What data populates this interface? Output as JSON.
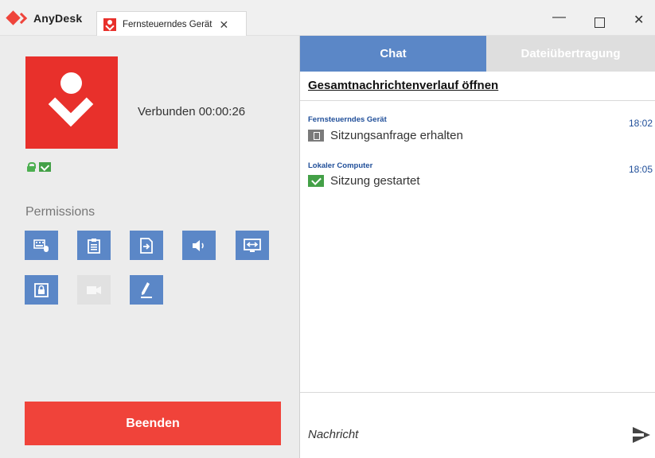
{
  "app": {
    "name": "AnyDesk"
  },
  "tab": {
    "label": "Fernsteuerndes Gerät"
  },
  "status": {
    "text": "Verbunden 00:00:26"
  },
  "permissions": {
    "heading": "Permissions",
    "items": [
      {
        "icon": "keyboard-mouse-icon",
        "enabled": true
      },
      {
        "icon": "clipboard-icon",
        "enabled": true
      },
      {
        "icon": "file-transfer-icon",
        "enabled": true
      },
      {
        "icon": "sound-icon",
        "enabled": true
      },
      {
        "icon": "control-icon",
        "enabled": true
      },
      {
        "icon": "lock-screen-icon",
        "enabled": true
      },
      {
        "icon": "record-session-icon",
        "enabled": false
      },
      {
        "icon": "draw-icon",
        "enabled": true
      }
    ]
  },
  "end_button": {
    "label": "Beenden"
  },
  "chat": {
    "tab_chat": "Chat",
    "tab_files": "Dateiübertragung",
    "history_link": "Gesamtnachrichtenverlauf öffnen",
    "messages": [
      {
        "sender": "Fernsteuerndes Gerät",
        "time": "18:02",
        "text": "Sitzungsanfrage erhalten",
        "icon": "session-request-icon"
      },
      {
        "sender": "Lokaler Computer",
        "time": "18:05",
        "text": "Sitzung gestartet",
        "icon": "session-started-icon"
      }
    ],
    "input_placeholder": "Nachricht"
  },
  "colors": {
    "accent": "#ef443b",
    "blue": "#5b87c7",
    "green": "#43a047"
  }
}
